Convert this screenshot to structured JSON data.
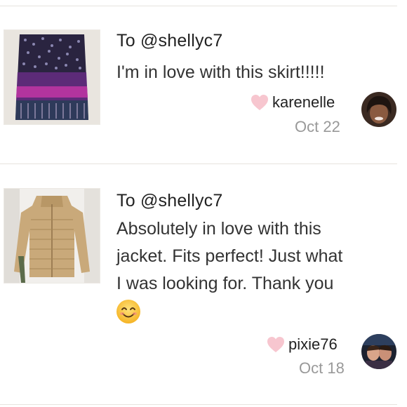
{
  "reviews": [
    {
      "to": "To @shellyc7",
      "message": "I'm in love with this skirt!!!!!",
      "username": "karenelle",
      "date": "Oct 22",
      "item": "sequin-skirt",
      "has_emoji": false
    },
    {
      "to": "To @shellyc7",
      "message": "Absolutely in love with this\njacket. Fits perfect! Just what\nI was looking for. Thank you",
      "username": "pixie76",
      "date": "Oct 18",
      "item": "puffer-jacket",
      "has_emoji": true,
      "emoji": "smiling-face-emoji"
    }
  ],
  "colors": {
    "text": "#222222",
    "muted": "#999999",
    "heart": "#f7c6cf",
    "divider": "#e6e3de"
  }
}
